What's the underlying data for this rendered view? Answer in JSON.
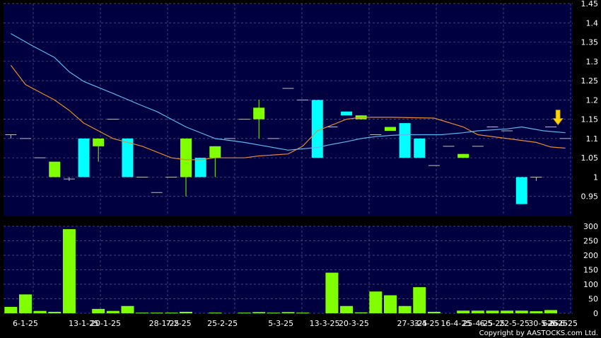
{
  "chart_data": {
    "type": "candlestick",
    "colors": {
      "background": "#000000",
      "panel": "#000040",
      "grid": "#5a5a8a",
      "up": "#00ffff",
      "down": "#80ff00",
      "flat": "#c0c0c0",
      "ma_fast": "#5bb8f0",
      "ma_slow": "#e88a30",
      "volume": "#80ff00",
      "marker": "#ffd700"
    },
    "price": {
      "ylim": [
        0.9,
        1.45
      ],
      "yticks": [
        "0.95",
        "1",
        "1.05",
        "1.1",
        "1.15",
        "1.2",
        "1.25",
        "1.3",
        "1.35",
        "1.4",
        "1.45"
      ],
      "yticks_values": [
        0.95,
        1.0,
        1.05,
        1.1,
        1.15,
        1.2,
        1.25,
        1.3,
        1.35,
        1.4,
        1.45
      ]
    },
    "volume": {
      "ylim": [
        0,
        300
      ],
      "yticks": [
        "0",
        "50",
        "100",
        "150",
        "200",
        "250",
        "300"
      ],
      "yticks_values": [
        0,
        50,
        100,
        150,
        200,
        250,
        300
      ]
    },
    "x_labels": [
      {
        "label": "6-1-25",
        "index": 1
      },
      {
        "label": "13-1-25",
        "index": 5
      },
      {
        "label": "20-1-25",
        "index": 6.5
      },
      {
        "label": "28-1-25",
        "index": 10.5
      },
      {
        "label": "7-2-25",
        "index": 11.5
      },
      {
        "label": "25-2-25",
        "index": 14.5
      },
      {
        "label": "5-3-25",
        "index": 18.5
      },
      {
        "label": "13-3-25",
        "index": 21.5
      },
      {
        "label": "20-3-25",
        "index": 23.5
      },
      {
        "label": "27-3-25",
        "index": 27.5
      },
      {
        "label": "3-4-25",
        "index": 28.5
      },
      {
        "label": "16-4-25",
        "index": 30.5
      },
      {
        "label": "25-4-25",
        "index": 32
      },
      {
        "label": "6-5-25",
        "index": 33
      },
      {
        "label": "22-5-25",
        "index": 34.5
      },
      {
        "label": "30-5-25",
        "index": 36.5
      },
      {
        "label": "6-6-25",
        "index": 37.3
      },
      {
        "label": "26-6-25",
        "index": 37.8
      }
    ],
    "candles": [
      {
        "o": 1.11,
        "h": 1.11,
        "l": 1.1,
        "c": 1.11
      },
      {
        "o": 1.1,
        "h": 1.1,
        "l": 1.1,
        "c": 1.1
      },
      {
        "o": 1.05,
        "h": 1.05,
        "l": 1.05,
        "c": 1.05
      },
      {
        "o": 1.04,
        "h": 1.04,
        "l": 1.0,
        "c": 1.0
      },
      {
        "o": 0.995,
        "h": 1.0,
        "l": 0.99,
        "c": 0.995
      },
      {
        "o": 1.0,
        "h": 1.1,
        "l": 1.0,
        "c": 1.1
      },
      {
        "o": 1.1,
        "h": 1.1,
        "l": 1.04,
        "c": 1.08
      },
      {
        "o": 1.15,
        "h": 1.15,
        "l": 1.15,
        "c": 1.15
      },
      {
        "o": 1.0,
        "h": 1.1,
        "l": 1.0,
        "c": 1.1
      },
      {
        "o": 1.0,
        "h": 1.0,
        "l": 1.0,
        "c": 1.0
      },
      {
        "o": 0.96,
        "h": 0.96,
        "l": 0.96,
        "c": 0.96
      },
      {
        "o": 1.0,
        "h": 1.0,
        "l": 1.0,
        "c": 1.0
      },
      {
        "o": 1.1,
        "h": 1.1,
        "l": 0.95,
        "c": 1.0
      },
      {
        "o": 1.0,
        "h": 1.05,
        "l": 1.0,
        "c": 1.05
      },
      {
        "o": 1.08,
        "h": 1.08,
        "l": 1.0,
        "c": 1.05
      },
      {
        "o": 1.1,
        "h": 1.1,
        "l": 1.1,
        "c": 1.1
      },
      {
        "o": 1.15,
        "h": 1.15,
        "l": 1.15,
        "c": 1.15
      },
      {
        "o": 1.18,
        "h": 1.2,
        "l": 1.1,
        "c": 1.15
      },
      {
        "o": 1.1,
        "h": 1.1,
        "l": 1.1,
        "c": 1.1
      },
      {
        "o": 1.23,
        "h": 1.23,
        "l": 1.23,
        "c": 1.23
      },
      {
        "o": 1.2,
        "h": 1.2,
        "l": 1.2,
        "c": 1.2
      },
      {
        "o": 1.05,
        "h": 1.2,
        "l": 1.05,
        "c": 1.2
      },
      {
        "o": 1.13,
        "h": 1.13,
        "l": 1.13,
        "c": 1.13
      },
      {
        "o": 1.16,
        "h": 1.17,
        "l": 1.16,
        "c": 1.17
      },
      {
        "o": 1.16,
        "h": 1.16,
        "l": 1.15,
        "c": 1.15
      },
      {
        "o": 1.11,
        "h": 1.11,
        "l": 1.11,
        "c": 1.11
      },
      {
        "o": 1.13,
        "h": 1.13,
        "l": 1.12,
        "c": 1.12
      },
      {
        "o": 1.05,
        "h": 1.14,
        "l": 1.05,
        "c": 1.14
      },
      {
        "o": 1.05,
        "h": 1.1,
        "l": 1.05,
        "c": 1.1
      },
      {
        "o": 1.03,
        "h": 1.03,
        "l": 1.03,
        "c": 1.03
      },
      {
        "o": 1.08,
        "h": 1.08,
        "l": 1.08,
        "c": 1.08
      },
      {
        "o": 1.06,
        "h": 1.06,
        "l": 1.05,
        "c": 1.05
      },
      {
        "o": 1.08,
        "h": 1.08,
        "l": 1.08,
        "c": 1.08
      },
      {
        "o": 1.13,
        "h": 1.13,
        "l": 1.13,
        "c": 1.13
      },
      {
        "o": 1.12,
        "h": 1.12,
        "l": 1.12,
        "c": 1.12
      },
      {
        "o": 0.93,
        "h": 1.0,
        "l": 0.93,
        "c": 1.0
      },
      {
        "o": 1.0,
        "h": 1.0,
        "l": 0.99,
        "c": 1.0
      },
      {
        "o": 1.13,
        "h": 1.13,
        "l": 1.13,
        "c": 1.13
      },
      {
        "o": 1.1,
        "h": 1.1,
        "l": 1.1,
        "c": 1.1
      }
    ],
    "ma_fast": [
      [
        0,
        1.372
      ],
      [
        1.5,
        1.34
      ],
      [
        3,
        1.31
      ],
      [
        4,
        1.273
      ],
      [
        5,
        1.248
      ],
      [
        7,
        1.217
      ],
      [
        9,
        1.185
      ],
      [
        10,
        1.17
      ],
      [
        11,
        1.15
      ],
      [
        12,
        1.13
      ],
      [
        14,
        1.1
      ],
      [
        15,
        1.095
      ],
      [
        16,
        1.09
      ],
      [
        17.5,
        1.08
      ],
      [
        19,
        1.07
      ],
      [
        21,
        1.077
      ],
      [
        22,
        1.085
      ],
      [
        23,
        1.092
      ],
      [
        24,
        1.1
      ],
      [
        25,
        1.105
      ],
      [
        26,
        1.108
      ],
      [
        27,
        1.11
      ],
      [
        28,
        1.11
      ],
      [
        29.5,
        1.11
      ],
      [
        31,
        1.115
      ],
      [
        32,
        1.12
      ],
      [
        34,
        1.125
      ],
      [
        35,
        1.13
      ],
      [
        36.5,
        1.12
      ],
      [
        38,
        1.115
      ]
    ],
    "ma_slow": [
      [
        0,
        1.29
      ],
      [
        1,
        1.24
      ],
      [
        2,
        1.22
      ],
      [
        3,
        1.2
      ],
      [
        4,
        1.173
      ],
      [
        5,
        1.14
      ],
      [
        6,
        1.12
      ],
      [
        7,
        1.1
      ],
      [
        9,
        1.08
      ],
      [
        11,
        1.05
      ],
      [
        12,
        1.045
      ],
      [
        13,
        1.045
      ],
      [
        14,
        1.05
      ],
      [
        15,
        1.05
      ],
      [
        16,
        1.05
      ],
      [
        17,
        1.055
      ],
      [
        19,
        1.06
      ],
      [
        20,
        1.08
      ],
      [
        21,
        1.12
      ],
      [
        22,
        1.135
      ],
      [
        23,
        1.15
      ],
      [
        24,
        1.155
      ],
      [
        26,
        1.155
      ],
      [
        29,
        1.153
      ],
      [
        31,
        1.13
      ],
      [
        32,
        1.11
      ],
      [
        34,
        1.1
      ],
      [
        36,
        1.09
      ],
      [
        37,
        1.078
      ],
      [
        38,
        1.075
      ]
    ],
    "volume_values": [
      22,
      65,
      8,
      5,
      290,
      0,
      15,
      8,
      25,
      2,
      2,
      2,
      5,
      0,
      2,
      0,
      2,
      4,
      2,
      4,
      2,
      0,
      140,
      25,
      3,
      75,
      62,
      25,
      90,
      5,
      0,
      9,
      9,
      9,
      9,
      9,
      7,
      11,
      0
    ],
    "marker_index": 37.2,
    "marker_price": 1.13,
    "copyright": "Copyright by AASTOCKS.com Ltd."
  }
}
